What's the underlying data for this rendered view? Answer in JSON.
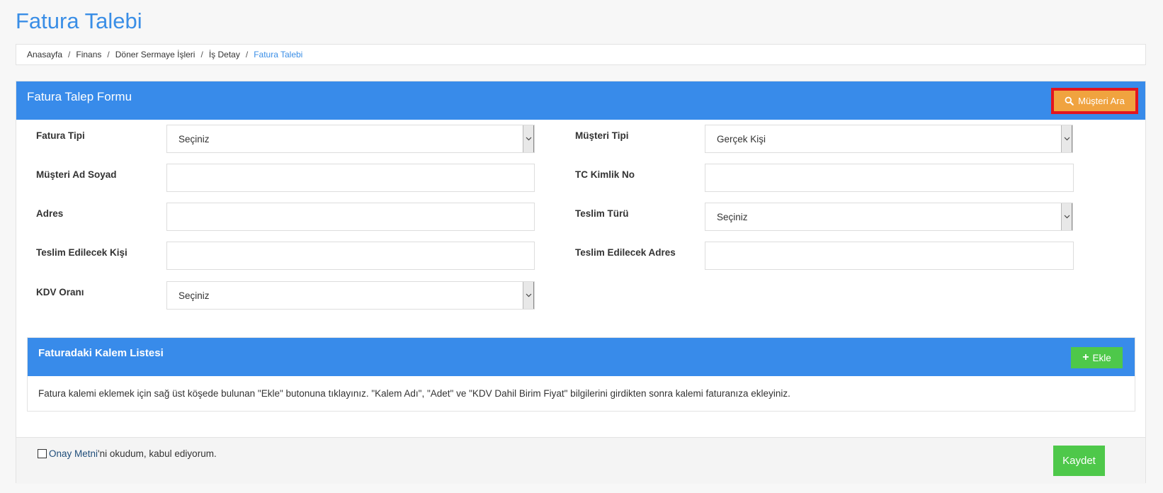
{
  "page": {
    "title": "Fatura Talebi"
  },
  "breadcrumb": [
    "Anasayfa",
    "Finans",
    "Döner Sermaye İşleri",
    "İş Detay",
    "Fatura Talebi"
  ],
  "breadcrumb_separator": "/",
  "panel": {
    "title": "Fatura Talep Formu",
    "search_button": {
      "label": "Müşteri Ara",
      "icon": "search-icon"
    }
  },
  "form": {
    "fatura_tipi": {
      "label": "Fatura Tipi",
      "value": "Seçiniz"
    },
    "musteri_tipi": {
      "label": "Müşteri Tipi",
      "value": "Gerçek Kişi"
    },
    "musteri_ad_soyad": {
      "label": "Müşteri Ad Soyad",
      "value": ""
    },
    "tc_kimlik_no": {
      "label": "TC Kimlik No",
      "value": ""
    },
    "adres": {
      "label": "Adres",
      "value": ""
    },
    "teslim_turu": {
      "label": "Teslim Türü",
      "value": "Seçiniz"
    },
    "teslim_edilecek_kisi": {
      "label": "Teslim Edilecek Kişi",
      "value": ""
    },
    "teslim_edilecek_adres": {
      "label": "Teslim Edilecek Adres",
      "value": ""
    },
    "kdv_orani": {
      "label": "KDV Oranı",
      "value": "Seçiniz"
    }
  },
  "item_list": {
    "title": "Faturadaki Kalem Listesi",
    "add_button": "Ekle",
    "add_icon": "plus-icon",
    "info": "Fatura kalemi eklemek için sağ üst köşede bulunan \"Ekle\" butonuna tıklayınız. \"Kalem Adı\", \"Adet\" ve \"KDV Dahil Birim Fiyat\" bilgilerini girdikten sonra kalemi faturanıza ekleyiniz."
  },
  "footer": {
    "consent_link": "Onay Metni",
    "consent_rest": "'ni okudum, kabul ediyorum.",
    "save_button": "Kaydet"
  },
  "colors": {
    "header_blue": "#388bea",
    "title_blue": "#3a8ee6",
    "search_orange": "#f0a33f",
    "highlight_red": "#e3151f",
    "success_green": "#4ec84a"
  }
}
